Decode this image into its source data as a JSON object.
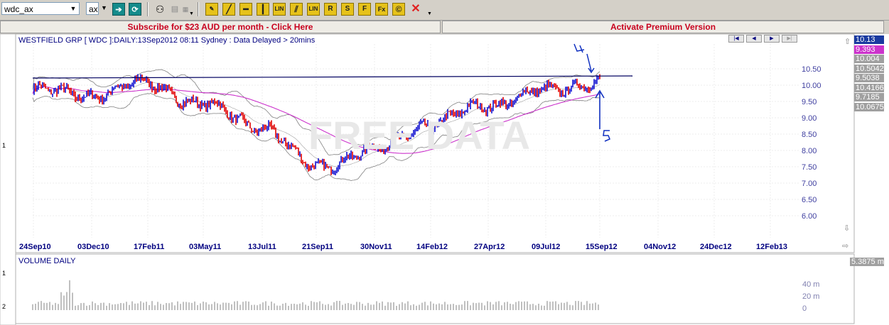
{
  "toolbar": {
    "symbol_value": "wdc_ax",
    "exchange_value": "ax",
    "tools": [
      "LIN",
      "LIN",
      "R",
      "S",
      "F",
      "Fx"
    ]
  },
  "banner": {
    "subscribe": "Subscribe for $23 AUD per month - Click Here",
    "premium": "Activate Premium Version"
  },
  "chart": {
    "title": "WESTFIELD GRP [ WDC ]:DAILY:13Sep2012 08:11 Sydney : Data Delayed > 20mins",
    "watermark": "FREE DATA",
    "y_ticks": [
      "10.50",
      "10.00",
      "9.50",
      "9.00",
      "8.50",
      "8.00",
      "7.50",
      "7.00",
      "6.50",
      "6.00"
    ],
    "x_ticks": [
      "24Sep10",
      "03Dec10",
      "17Feb11",
      "03May11",
      "13Jul11",
      "21Sep11",
      "30Nov11",
      "14Feb12",
      "27Apr12",
      "09Jul12",
      "15Sep12",
      "04Nov12",
      "24Dec12",
      "12Feb13"
    ],
    "pane_label": "1",
    "annotations": [
      "4",
      "5"
    ],
    "badges": [
      {
        "value": "10.13",
        "bg": "#1a3aa0",
        "fg": "#ffffff"
      },
      {
        "value": "9.393",
        "bg": "#cc33cc",
        "fg": "#ffffff"
      },
      {
        "value": "10.004",
        "bg": "#a0a0a0",
        "fg": "#ffffff"
      },
      {
        "value": "10.5042",
        "bg": "#a0a0a0",
        "fg": "#ffffff"
      },
      {
        "value": "9.5038",
        "bg": "#a0a0a0",
        "fg": "#ffffff"
      },
      {
        "value": "10.4166",
        "bg": "#a0a0a0",
        "fg": "#ffffff"
      },
      {
        "value": "9.7185",
        "bg": "#a0a0a0",
        "fg": "#ffffff"
      },
      {
        "value": "10.0675",
        "bg": "#a0a0a0",
        "fg": "#ffffff"
      }
    ]
  },
  "volume": {
    "title": "VOLUME DAILY",
    "badge": "5.3875 m",
    "ticks": [
      "40 m",
      "20 m",
      "0"
    ],
    "pane_labels": [
      "1",
      "2"
    ]
  },
  "chart_data": {
    "type": "line",
    "x": [
      "24Sep10",
      "03Dec10",
      "17Feb11",
      "03May11",
      "13Jul11",
      "21Sep11",
      "30Nov11",
      "14Feb12",
      "27Apr12",
      "09Jul12",
      "15Sep12"
    ],
    "series": [
      {
        "values": [
          9.85,
          9.7,
          10.05,
          9.4,
          8.75,
          7.5,
          8.0,
          8.8,
          9.4,
          9.8,
          10.13
        ]
      }
    ],
    "ylim": [
      6.0,
      10.5
    ],
    "colors": {
      "up": "#1010d0",
      "down": "#e00000",
      "ma": "#cc33cc",
      "band": "#808080",
      "resistance": "#000060",
      "annotation": "#1030c0"
    }
  }
}
